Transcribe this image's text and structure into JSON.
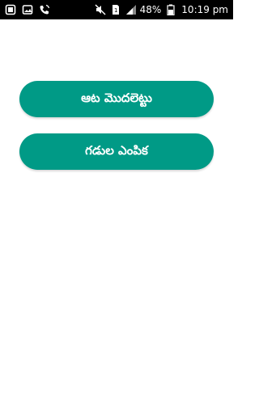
{
  "status_bar": {
    "battery_percent": "48%",
    "time": "10:19 pm",
    "icons": [
      "notification-icon",
      "gallery-icon",
      "phone-call-icon",
      "mute-icon",
      "sim-icon",
      "signal-icon",
      "battery-icon"
    ]
  },
  "menu": {
    "start_game_label": "ఆట మొదలెట్టు",
    "grid_select_label": "గడుల ఎంపిక"
  },
  "colors": {
    "button_bg": "#009a86",
    "status_bar_bg": "#000000"
  }
}
